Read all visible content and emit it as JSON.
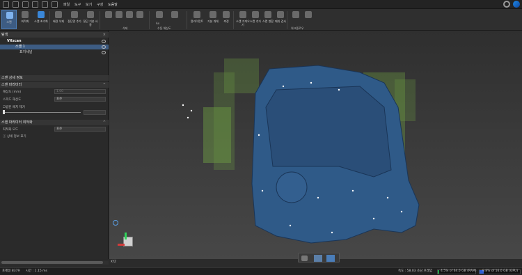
{
  "menu": {
    "items": [
      "파일",
      "도구",
      "보기",
      "구성",
      "도움말"
    ]
  },
  "ribbon": {
    "buttons": [
      {
        "label": "스캔",
        "icon": "scan-icon"
      },
      {
        "label": "최적화",
        "icon": "optimize-icon"
      },
      {
        "label": "스캔 초기화",
        "icon": "scan-reset-icon"
      },
      {
        "label": "배경 삭제",
        "icon": "delete-background-icon"
      },
      {
        "label": "절단면 추가",
        "icon": "add-cut-plane-icon"
      },
      {
        "label": "절단 기본 사용",
        "icon": "cut-default-icon"
      },
      {
        "label": "",
        "icon": "select-icon"
      },
      {
        "label": "",
        "icon": "lasso-icon"
      },
      {
        "label": "",
        "icon": "brush-icon"
      },
      {
        "label": "",
        "icon": "delete-icon"
      },
      {
        "label": "",
        "icon": "move-icon"
      },
      {
        "label": "",
        "icon": "rotate-icon"
      },
      {
        "label": "얼라이먼트",
        "icon": "alignment-icon"
      },
      {
        "label": "기본 개체",
        "icon": "primitive-icon"
      },
      {
        "label": "측정",
        "icon": "measure-icon"
      },
      {
        "label": "스캔 가져오기",
        "icon": "import-scan-icon"
      },
      {
        "label": "스캔 추가",
        "icon": "add-scan-icon"
      },
      {
        "label": "스캔 병합",
        "icon": "merge-scan-icon"
      },
      {
        "label": "메쉬 검사",
        "icon": "mesh-inspect-icon"
      },
      {
        "label": "",
        "icon": "workflow-a-icon"
      },
      {
        "label": "",
        "icon": "workflow-b-icon"
      }
    ],
    "groups": [
      "삭제",
      "수동 해상도",
      "워크플로우"
    ],
    "resolution_label": "Ax"
  },
  "explorer": {
    "title": "탐색",
    "project": "VXscan",
    "scan": "스캔 1",
    "target": "표지세널"
  },
  "scan_info": {
    "title": "스캔 상세 정보"
  },
  "scan_params": {
    "title": "스캔 파라미터",
    "resolution_label": "해상도 (mm)",
    "resolution_value": "1.00",
    "speed_label": "스피드 해상도",
    "speed_value": "표준",
    "noise_label": "고립된 패치 제거"
  },
  "optimize": {
    "title": "스캔 파라미터 최적화",
    "mode_label": "최적화 모드",
    "mode_value": "표준",
    "detail_button": "상세 정보 표기"
  },
  "viewport": {
    "axis_label": "XYZ"
  },
  "status": {
    "targets": "포제일 8379",
    "time": "시간 : 1.15 ms",
    "fps": "속도 : 58.03 초당 프레임",
    "ram": "4.5% of 64.0 GB (RAM)",
    "ram_pct": 0.045,
    "gpu": "9.8% of 16.0 GB (GPU)",
    "gpu_pct": 0.098
  },
  "colors": {
    "accent": "#3a87d8",
    "part": "#2f5a88",
    "point_cloud": "#8bd64a",
    "ram": "#23a84a",
    "gpu": "#2d5fd6"
  }
}
